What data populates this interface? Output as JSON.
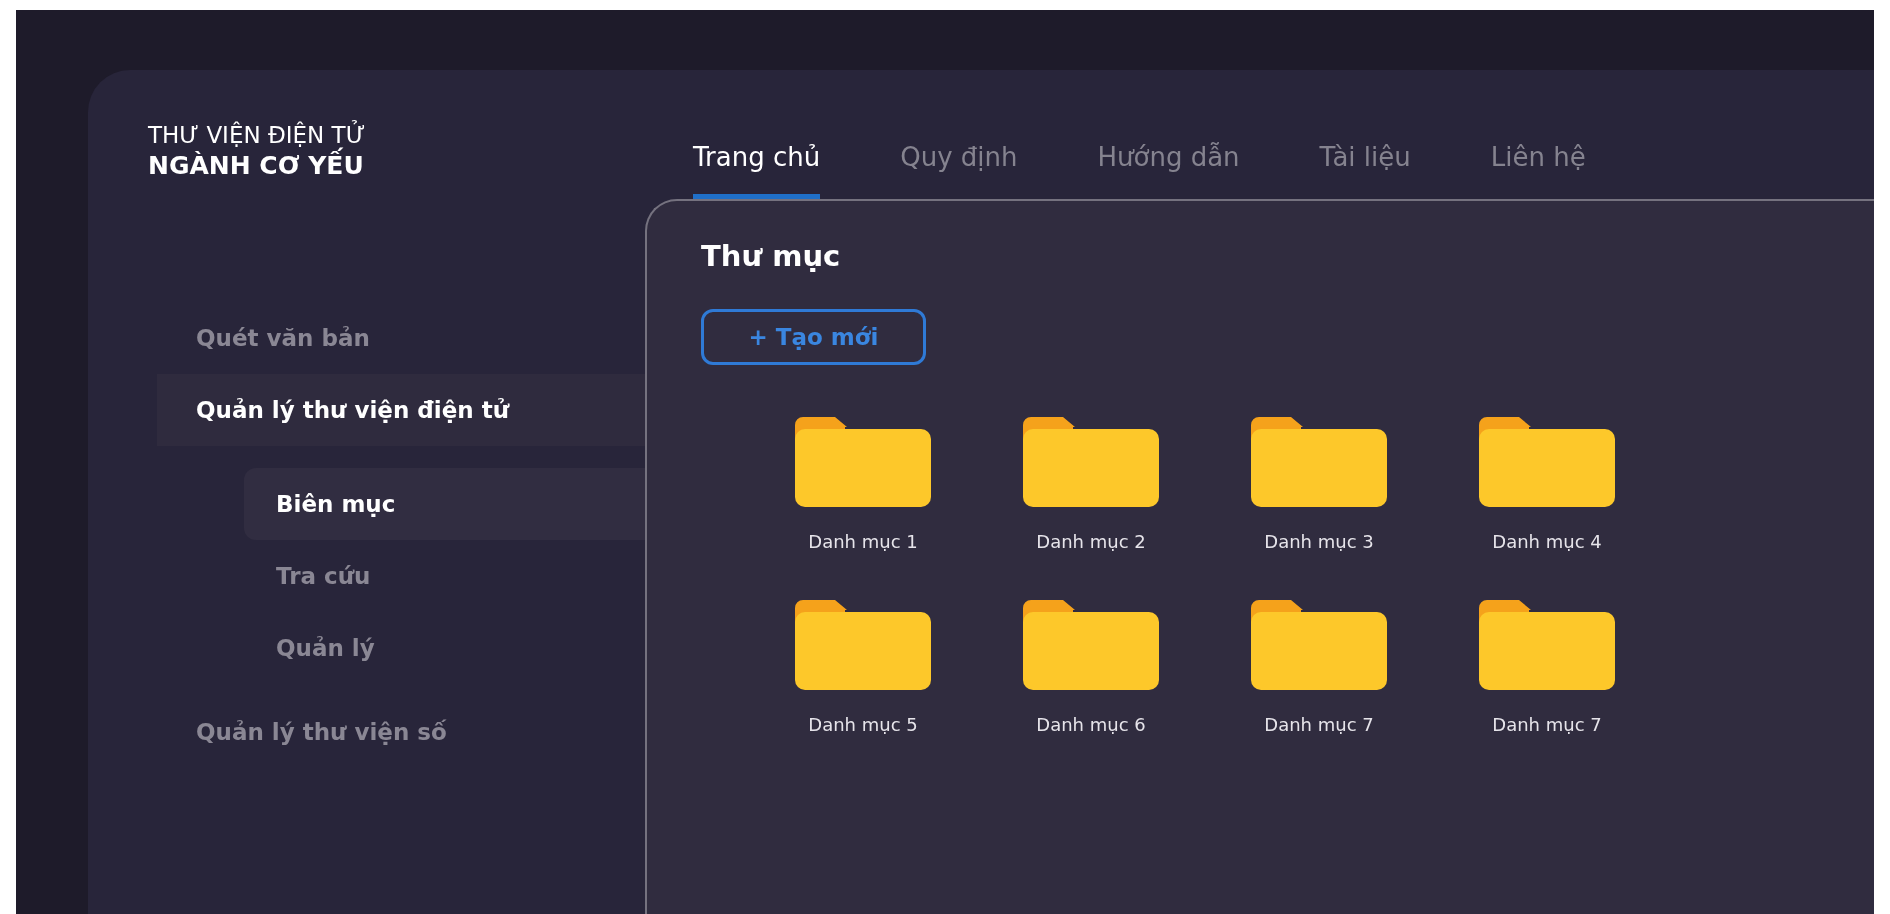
{
  "brand": {
    "line_1": "THƯ VIỆN ĐIỆN TỬ",
    "line_2": "NGÀNH CƠ YẾU"
  },
  "tabs": [
    {
      "label": "Trang chủ",
      "selected": true
    },
    {
      "label": "Quy định",
      "selected": false
    },
    {
      "label": "Hướng dẫn",
      "selected": false
    },
    {
      "label": "Tài liệu",
      "selected": false
    },
    {
      "label": "Liên hệ",
      "selected": false
    }
  ],
  "sidebar": {
    "items": [
      {
        "label": "Quét văn bản",
        "selected": false
      },
      {
        "label": "Quản lý thư viện điện tử",
        "selected": true,
        "children": [
          {
            "label": "Biên mục",
            "selected": true
          },
          {
            "label": "Tra cứu",
            "selected": false
          },
          {
            "label": "Quản lý",
            "selected": false
          }
        ]
      },
      {
        "label": "Quản lý thư viện số",
        "selected": false
      }
    ]
  },
  "panel": {
    "title": "Thư mục",
    "create_button": "+ Tạo mới",
    "folders": [
      {
        "label": "Danh mục 1"
      },
      {
        "label": "Danh mục 2"
      },
      {
        "label": "Danh mục 3"
      },
      {
        "label": "Danh mục 4"
      },
      {
        "label": "Danh mục 5"
      },
      {
        "label": "Danh mục 6"
      },
      {
        "label": "Danh mục 7"
      },
      {
        "label": "Danh mục 7"
      }
    ]
  }
}
